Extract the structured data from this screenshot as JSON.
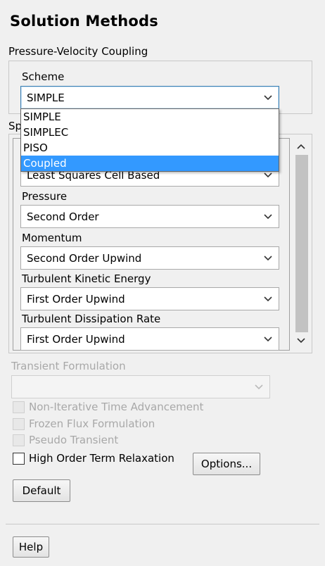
{
  "panel": {
    "title": "Solution Methods"
  },
  "pv_coupling": {
    "group_label": "Pressure-Velocity Coupling",
    "scheme_label": "Scheme",
    "scheme_value": "SIMPLE",
    "scheme_options": [
      "SIMPLE",
      "SIMPLEC",
      "PISO",
      "Coupled"
    ],
    "highlighted_option": "Coupled"
  },
  "spatial": {
    "group_label_visible": "Sp",
    "hidden_combo_value": "Least Squares Cell Based",
    "fields": [
      {
        "label": "Pressure",
        "value": "Second Order"
      },
      {
        "label": "Momentum",
        "value": "Second Order Upwind"
      },
      {
        "label": "Turbulent Kinetic Energy",
        "value": "First Order Upwind"
      },
      {
        "label": "Turbulent Dissipation Rate",
        "value": "First Order Upwind"
      }
    ]
  },
  "transient": {
    "label": "Transient Formulation",
    "value": ""
  },
  "options": {
    "non_iterative": "Non-Iterative Time Advancement",
    "frozen_flux": "Frozen Flux Formulation",
    "pseudo_transient": "Pseudo Transient",
    "high_order": "High Order Term Relaxation",
    "options_button": "Options..."
  },
  "buttons": {
    "default": "Default",
    "help": "Help"
  },
  "icons": {
    "dropdown": "chevron-down-icon",
    "scroll_up": "chevron-up-icon",
    "scroll_down": "chevron-down-icon"
  }
}
